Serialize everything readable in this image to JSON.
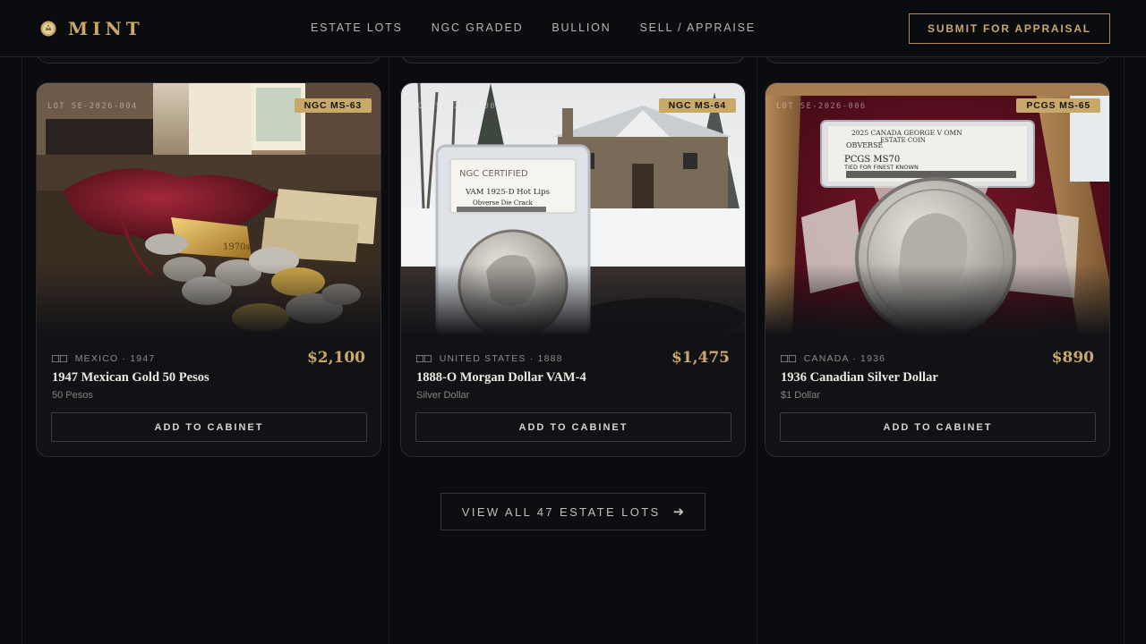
{
  "brand": {
    "name": "MINT",
    "logo_icon": "coin-crest-icon"
  },
  "nav": {
    "items": [
      {
        "label": "ESTATE LOTS"
      },
      {
        "label": "NGC GRADED"
      },
      {
        "label": "BULLION"
      },
      {
        "label": "SELL / APPRAISE"
      }
    ],
    "cta_label": "SUBMIT FOR APPRAISAL"
  },
  "cards": [
    {
      "lot": "LOT SE-2026-004",
      "grade": "NGC MS-63",
      "flag": "□□",
      "origin": "MEXICO · 1947",
      "price": "$2,100",
      "name": "1947 Mexican Gold 50 Pesos",
      "denomination": "50 Pesos",
      "button_label": "ADD TO CABINET",
      "photo": {
        "ingot_text": "1970s"
      }
    },
    {
      "lot": "LOT SE-2026-005",
      "grade": "NGC MS-64",
      "flag": "□□",
      "origin": "UNITED STATES · 1888",
      "price": "$1,475",
      "name": "1888-O Morgan Dollar VAM-4",
      "denomination": "Silver Dollar",
      "button_label": "ADD TO CABINET",
      "photo": {
        "slab_brand": "NGC CERTIFIED",
        "slab_title": "VAM 1925-D Hot Lips",
        "slab_sub": "Obverse Die Crack"
      }
    },
    {
      "lot": "LOT SE-2026-006",
      "grade": "PCGS MS-65",
      "flag": "□□",
      "origin": "CANADA · 1936",
      "price": "$890",
      "name": "1936 Canadian Silver Dollar",
      "denomination": "$1 Dollar",
      "button_label": "ADD TO CABINET",
      "photo": {
        "label_line1": "2025 CANADA GEORGE V OMN",
        "label_line2": "ESTATE COIN",
        "label_line3": "OBVERSE",
        "label_grade": "PCGS MS70",
        "label_note": "TIED FOR FINEST KNOWN"
      }
    }
  ],
  "view_all": {
    "label": "VIEW ALL 47 ESTATE LOTS",
    "icon": "arrow-right-icon"
  },
  "colors": {
    "accent": "#c9a96a",
    "background": "#0b0c0f",
    "card": "#111216"
  }
}
